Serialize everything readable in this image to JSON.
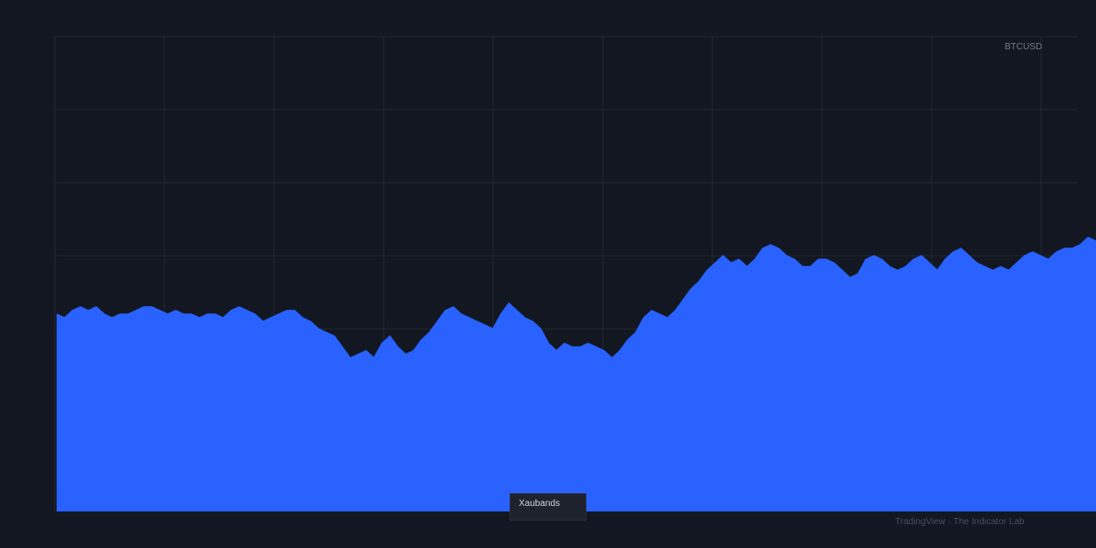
{
  "chart_data": {
    "type": "area",
    "symbol": "BTCUSD",
    "grid": true,
    "legend": "top-right",
    "ylim": [
      0,
      13
    ],
    "series": [
      {
        "name": "BTCUSD",
        "color": "#2962ff",
        "values": [
          5.4,
          5.3,
          5.5,
          5.6,
          5.5,
          5.6,
          5.4,
          5.3,
          5.4,
          5.4,
          5.5,
          5.6,
          5.6,
          5.5,
          5.4,
          5.5,
          5.4,
          5.4,
          5.3,
          5.4,
          5.4,
          5.3,
          5.5,
          5.6,
          5.5,
          5.4,
          5.2,
          5.3,
          5.4,
          5.5,
          5.5,
          5.3,
          5.2,
          5.0,
          4.9,
          4.8,
          4.5,
          4.2,
          4.3,
          4.4,
          4.2,
          4.6,
          4.8,
          4.5,
          4.3,
          4.4,
          4.7,
          4.9,
          5.2,
          5.5,
          5.6,
          5.4,
          5.3,
          5.2,
          5.1,
          5.0,
          5.4,
          5.7,
          5.5,
          5.3,
          5.2,
          5.0,
          4.6,
          4.4,
          4.6,
          4.5,
          4.5,
          4.6,
          4.5,
          4.4,
          4.2,
          4.4,
          4.7,
          4.9,
          5.3,
          5.5,
          5.4,
          5.3,
          5.5,
          5.8,
          6.1,
          6.3,
          6.6,
          6.8,
          7.0,
          6.8,
          6.9,
          6.7,
          6.9,
          7.2,
          7.3,
          7.2,
          7.0,
          6.9,
          6.7,
          6.7,
          6.9,
          6.9,
          6.8,
          6.6,
          6.4,
          6.5,
          6.9,
          7.0,
          6.9,
          6.7,
          6.6,
          6.7,
          6.9,
          7.0,
          6.8,
          6.6,
          6.9,
          7.1,
          7.2,
          7.0,
          6.8,
          6.7,
          6.6,
          6.7,
          6.6,
          6.8,
          7.0,
          7.1,
          7.0,
          6.9,
          7.1,
          7.2,
          7.2,
          7.3,
          7.5,
          7.4
        ]
      }
    ]
  },
  "legend": {
    "symbol": "BTCUSD"
  },
  "tooltip": {
    "label": "Xaubands"
  },
  "watermark": {
    "text": "TradingView · The Indicator Lab"
  },
  "colors": {
    "background": "#131722",
    "grid": "#232733",
    "area_fill": "#2962ff",
    "area_line": "#2962ff",
    "text_muted": "#787b86"
  }
}
